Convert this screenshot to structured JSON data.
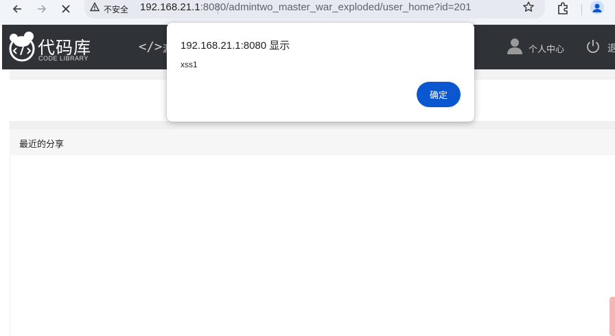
{
  "browser": {
    "back_icon": "arrow-left-icon",
    "forward_icon": "arrow-right-icon",
    "stop_icon": "close-icon",
    "security_label": "不安全",
    "url_host": "192.168.21.1",
    "url_rest": ":8080/admintwo_master_war_exploded/user_home?id=201",
    "accent": "#0b57d0"
  },
  "site": {
    "logo_title": "代码库",
    "logo_subtitle": "CODE LIBRARY",
    "nav_code_label": "源",
    "nav_personal_label": "个人中心",
    "nav_logout_label": "退",
    "header_color": "#2f3237"
  },
  "content": {
    "recent_title": "最近的分享"
  },
  "dialog": {
    "title": "192.168.21.1:8080 显示",
    "message": "xss1",
    "ok_label": "确定"
  }
}
